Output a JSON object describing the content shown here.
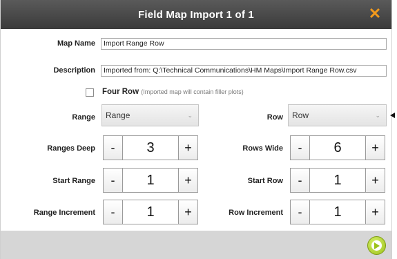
{
  "dialog": {
    "title": "Field Map Import 1 of 1",
    "close_icon": "close-x-icon",
    "accent_color": "#f39a1c"
  },
  "form": {
    "map_name": {
      "label": "Map Name",
      "value": "Import Range Row"
    },
    "description": {
      "label": "Description",
      "value": "Imported from: Q:\\Technical Communications\\HM Maps\\Import Range Row.csv"
    },
    "four_row": {
      "label": "Four Row",
      "note": "(Imported map will contain filler plots)",
      "checked": false
    },
    "range": {
      "label": "Range",
      "selected": "Range"
    },
    "row": {
      "label": "Row",
      "selected": "Row"
    },
    "ranges_deep": {
      "label": "Ranges Deep",
      "value": "3"
    },
    "rows_wide": {
      "label": "Rows Wide",
      "value": "6"
    },
    "start_range": {
      "label": "Start Range",
      "value": "1"
    },
    "start_row": {
      "label": "Start Row",
      "value": "1"
    },
    "range_increment": {
      "label": "Range Increment",
      "value": "1"
    },
    "row_increment": {
      "label": "Row Increment",
      "value": "1"
    },
    "minus": "-",
    "plus": "+"
  },
  "footer": {
    "next_icon": "next-arrow-icon",
    "next_color": "#9cc21a"
  }
}
